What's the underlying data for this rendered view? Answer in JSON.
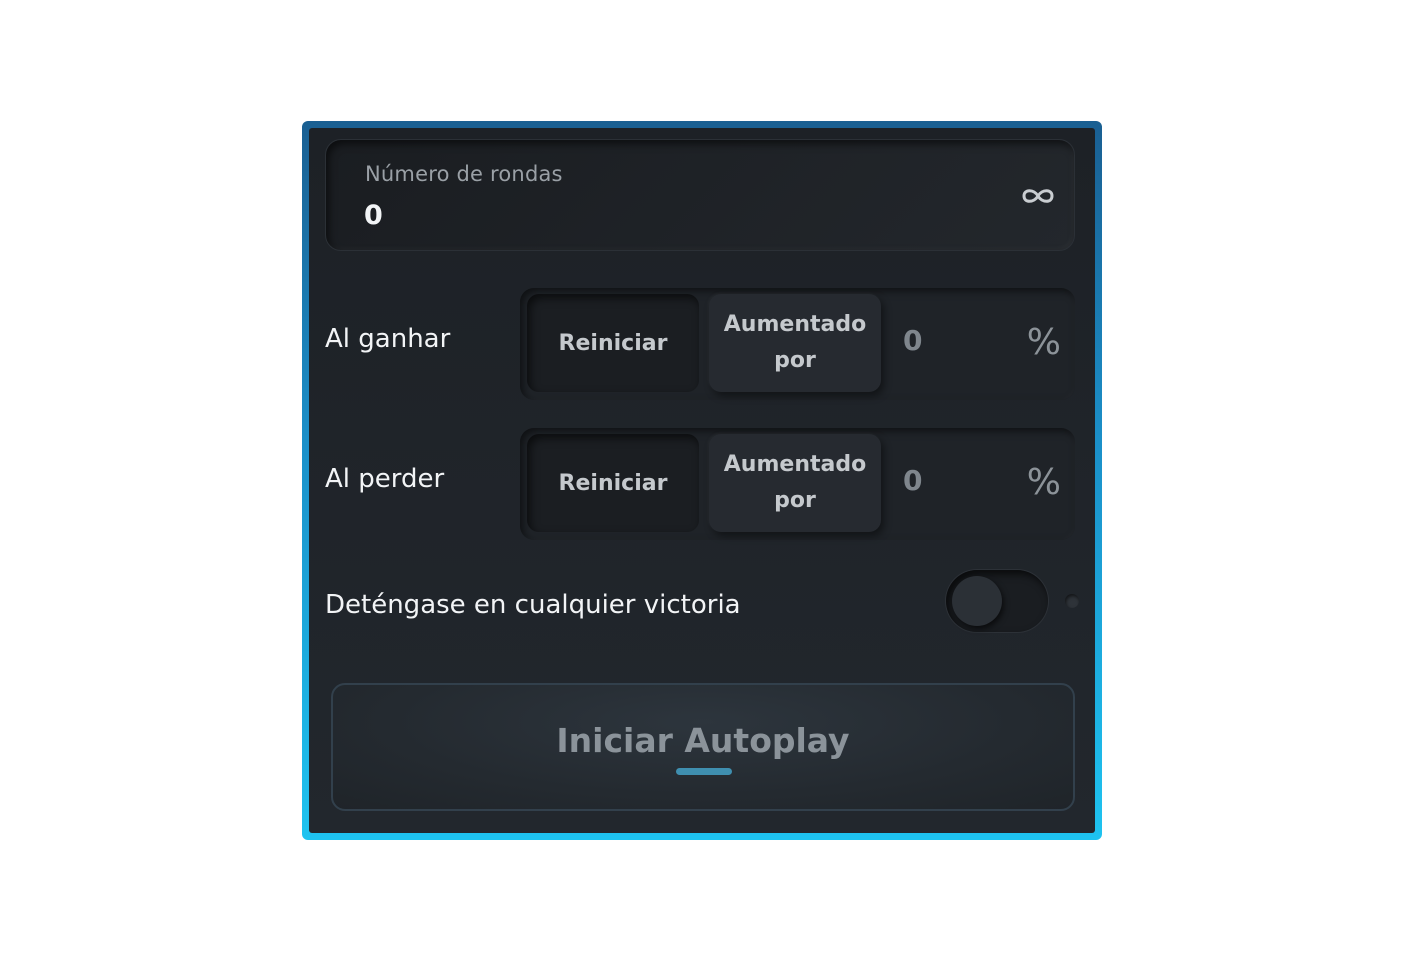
{
  "rounds": {
    "label": "Número de rondas",
    "value": "0",
    "icon": "infinity-icon"
  },
  "on_win": {
    "label": "Al ganhar",
    "reset_label": "Reiniciar",
    "increase_label": "Aumentado por",
    "value": "0",
    "unit": "%"
  },
  "on_loss": {
    "label": "Al perder",
    "reset_label": "Reiniciar",
    "increase_label": "Aumentado por",
    "value": "0",
    "unit": "%"
  },
  "stop_on_win": {
    "label": "Deténgase en cualquier victoria",
    "enabled": false
  },
  "start_button": {
    "label": "Iniciar Autoplay"
  },
  "colors": {
    "frame_top": "#1a5f92",
    "frame_bottom": "#1ec3f0",
    "panel": "#1d2126",
    "accent": "#3f8fb0"
  }
}
